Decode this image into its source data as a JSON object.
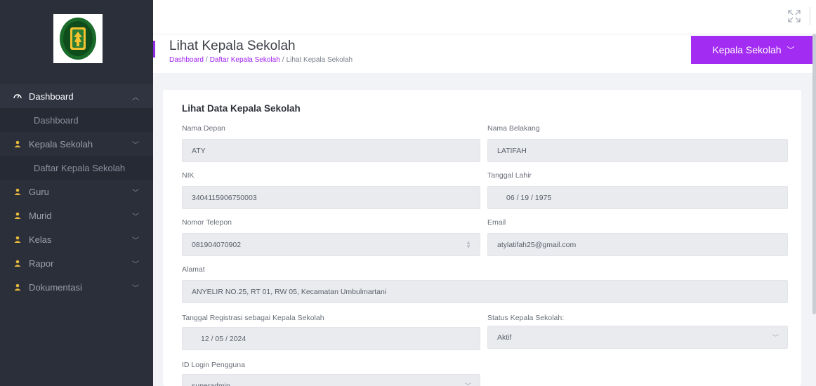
{
  "sidebar": {
    "menu": [
      {
        "label": "Dashboard",
        "icon": "dashboard-icon",
        "expanded": true,
        "children": [
          "Dashboard"
        ]
      },
      {
        "label": "Kepala Sekolah",
        "icon": "user-icon",
        "expanded": true,
        "children": [
          "Daftar Kepala Sekolah"
        ]
      },
      {
        "label": "Guru",
        "icon": "user-icon",
        "expanded": false
      },
      {
        "label": "Murid",
        "icon": "user-icon",
        "expanded": false
      },
      {
        "label": "Kelas",
        "icon": "user-icon",
        "expanded": false
      },
      {
        "label": "Rapor",
        "icon": "user-icon",
        "expanded": false
      },
      {
        "label": "Dokumentasi",
        "icon": "user-icon",
        "expanded": false
      }
    ],
    "accent_color": "#e8b93a"
  },
  "header": {
    "title": "Lihat Kepala Sekolah",
    "breadcrumb": [
      "Dashboard",
      "Daftar Kepala Sekolah",
      "Lihat Kepala Sekolah"
    ],
    "user_button": "Kepala Sekolah",
    "accent_color": "#a32cf2"
  },
  "form": {
    "title": "Lihat Data Kepala Sekolah",
    "nama_depan": {
      "label": "Nama Depan",
      "value": "ATY"
    },
    "nama_belakang": {
      "label": "Nama Belakang",
      "value": "LATIFAH"
    },
    "nik": {
      "label": "NIK",
      "value": "3404115906750003"
    },
    "tanggal_lahir": {
      "label": "Tanggal Lahir",
      "value": "06 / 19 / 1975"
    },
    "nomor_telepon": {
      "label": "Nomor Telepon",
      "value": "081904070902"
    },
    "email": {
      "label": "Email",
      "value": "atylatifah25@gmail.com"
    },
    "alamat": {
      "label": "Alamat",
      "value": "ANYELIR NO.25, RT 01, RW 05, Kecamatan Umbulmartani"
    },
    "tanggal_registrasi": {
      "label": "Tanggal Registrasi sebagai Kepala Sekolah",
      "value": "12 / 05 / 2024"
    },
    "status": {
      "label": "Status Kepala Sekolah:",
      "value": "Aktif"
    },
    "id_login": {
      "label": "ID Login Pengguna",
      "value": "superadmin"
    }
  }
}
